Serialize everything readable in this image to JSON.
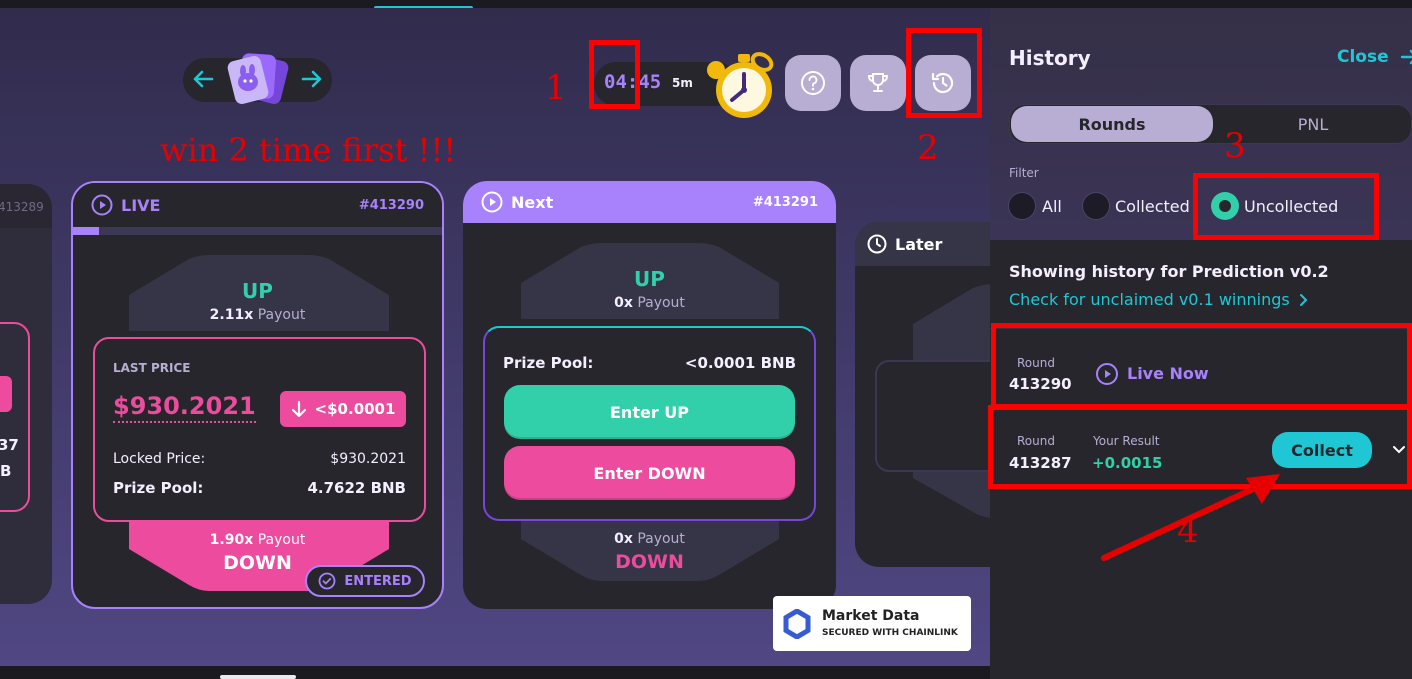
{
  "pair_selector": {
    "prev_icon": "arrow-left-icon",
    "next_icon": "arrow-right-icon",
    "logo": "bunny-cards-logo"
  },
  "timer": {
    "value": "04:45",
    "interval": "5m"
  },
  "annotations": {
    "note": "win 2 time first !!!",
    "n1": "1",
    "n2": "2",
    "n3": "3",
    "n4": "4",
    "color": "#ff0000"
  },
  "cards": {
    "prev": {
      "round_id": "413289",
      "frag_a": "37",
      "frag_b": "B"
    },
    "live": {
      "label": "LIVE",
      "round_id": "#413290",
      "up_label": "UP",
      "up_payout_mult": "2.11x",
      "up_payout_word": "Payout",
      "last_price_label": "LAST PRICE",
      "last_price": "$930.2021",
      "price_change": "<$0.0001",
      "locked_price_label": "Locked Price:",
      "locked_price": "$930.2021",
      "prize_pool_label": "Prize Pool:",
      "prize_pool": "4.7622 BNB",
      "down_payout_mult": "1.90x",
      "down_payout_word": "Payout",
      "down_label": "DOWN",
      "entered_label": "ENTERED"
    },
    "next": {
      "label": "Next",
      "round_id": "#413291",
      "up_label": "UP",
      "up_payout_mult": "0x",
      "up_payout_word": "Payout",
      "prize_pool_label": "Prize Pool:",
      "prize_pool": "<0.0001 BNB",
      "enter_up": "Enter UP",
      "enter_down": "Enter DOWN",
      "down_payout_mult": "0x",
      "down_payout_word": "Payout",
      "down_label": "DOWN"
    },
    "later": {
      "label": "Later"
    }
  },
  "chainlink": {
    "title": "Market Data",
    "subtitle": "SECURED WITH CHAINLINK"
  },
  "history": {
    "title": "History",
    "close": "Close",
    "tabs": [
      "Rounds",
      "PNL"
    ],
    "active_tab": "Rounds",
    "filter_label": "Filter",
    "filters": [
      "All",
      "Collected",
      "Uncollected"
    ],
    "selected_filter": "Uncollected",
    "showing_text": "Showing history for Prediction v0.2",
    "check_link": "Check for unclaimed v0.1 winnings",
    "rows": [
      {
        "round_label": "Round",
        "round": "413290",
        "status": "Live Now"
      },
      {
        "round_label": "Round",
        "round": "413287",
        "result_label": "Your Result",
        "result": "+0.0015",
        "action": "Collect"
      }
    ]
  },
  "colors": {
    "accent_cyan": "#1fc7d4",
    "purple": "#a881fc",
    "up_green": "#31d0aa",
    "down_pink": "#ed4b9e",
    "card_bg": "#27262c"
  }
}
